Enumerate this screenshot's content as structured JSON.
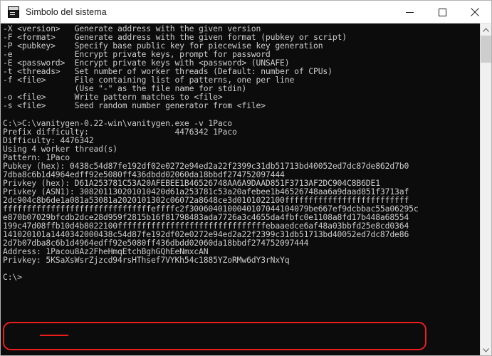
{
  "window": {
    "title": "Simbolo del sistema",
    "icon": "command-prompt-icon",
    "minimize_label": "—",
    "maximize_label": "☐",
    "close_label": "✕"
  },
  "scrollbar": {
    "up_arrow": "⌃",
    "down_arrow": "⌄"
  },
  "terminal": {
    "lines": [
      "-X <version>   Generate address with the given version",
      "-F <format>    Generate address with the given format (pubkey or script)",
      "-P <pubkey>    Specify base public key for piecewise key generation",
      "-e             Encrypt private keys, prompt for password",
      "-E <password>  Encrypt private keys with <password> (UNSAFE)",
      "-t <threads>   Set number of worker threads (Default: number of CPUs)",
      "-f <file>      File containing list of patterns, one per line",
      "               (Use \"-\" as the file name for stdin)",
      "-o <file>      Write pattern matches to <file>",
      "-s <file>      Seed random number generator from <file>",
      "",
      "C:\\>C:\\vanitygen-0.22-win\\vanitygen.exe -v 1Paco",
      "Prefix difficulty:                  4476342 1Paco",
      "Difficulty: 4476342",
      "Using 4 worker thread(s)",
      "Pattern: 1Paco",
      "Pubkey (hex): 0438c54d87fe192df02e0272e94ed2a22f2399c31db51713bd40052ed7dc87de862d7b0",
      "7dba8c6b1d4964edff92e5080ff436dbdd02060da18bbdf274752097444",
      "Privkey (hex): D61A253781C53A20AFEBEE1B46526748AA6A9DAAD851F3713AF2DC904C8B6DE1",
      "Privkey (ASN1): 308201130201010420d61a253781c53a20afebee1b46526748aa6a9daad851f3713af",
      "2dc904c8b6de1a081a53081a2020101302c06072a8648ce3d0101022100ffffffffffffffffffffffffff",
      "fffffffffffffffffffffffffffffffeffffc2f3006040100040107044104079be667ef9dcbbac55a06295c",
      "e870b07029bfcdb2dce28d959f2815b16f81798483ada7726a3c4655da4fbfc0e1108a8fd17b448a68554",
      "199c47d08ffb10d4b8022100fffffffffffffffffffffffffffffffebaaedce6af48a03bbfd25e8cd0364",
      "141020101a1440342000438c54d87fe192df02e0272e94ed2a22f2399c31db51713bd40052ed7dc87de86",
      "2d7b07dba8c6b1d4964edff92e5080ff436dbdd02060da18bbdf274752097444",
      "Address: 1Pacou8Az2FheHmqEtchBghGQhEeNmxcAN",
      "Privkey: 5KSaXsWsrZjzcd94rsHThsef7VYKh54c1885YZoRMw6dY3rNxYq",
      "",
      "C:\\>"
    ],
    "highlight_color": "#ef1c1c",
    "background": "#0c0c0c",
    "foreground": "#cccccc"
  }
}
